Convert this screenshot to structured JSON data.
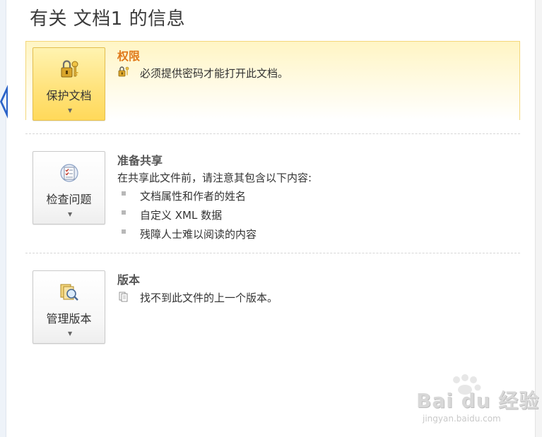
{
  "page": {
    "title": "有关 文档1 的信息"
  },
  "permissions": {
    "button_label": "保护文档",
    "title": "权限",
    "description": "必须提供密码才能打开此文档。",
    "button_icon": "lock-key-icon",
    "desc_icon": "lock-small-icon"
  },
  "prepare_sharing": {
    "button_label": "检查问题",
    "title": "准备共享",
    "description": "在共享此文件前，请注意其包含以下内容:",
    "items": [
      "文档属性和作者的姓名",
      "自定义 XML 数据",
      "残障人士难以阅读的内容"
    ],
    "button_icon": "checklist-icon"
  },
  "versions": {
    "button_label": "管理版本",
    "title": "版本",
    "description": "找不到此文件的上一个版本。",
    "button_icon": "versions-magnifier-icon",
    "desc_icon": "document-versions-icon"
  },
  "watermark": {
    "main": "Bai du 经验",
    "sub": "jingyan.baidu.com"
  },
  "colors": {
    "accent_orange": "#e0791a",
    "highlight_bg": "#fff5c4",
    "highlight_border": "#f4d77a",
    "nav_arrow": "#2b63c8"
  }
}
